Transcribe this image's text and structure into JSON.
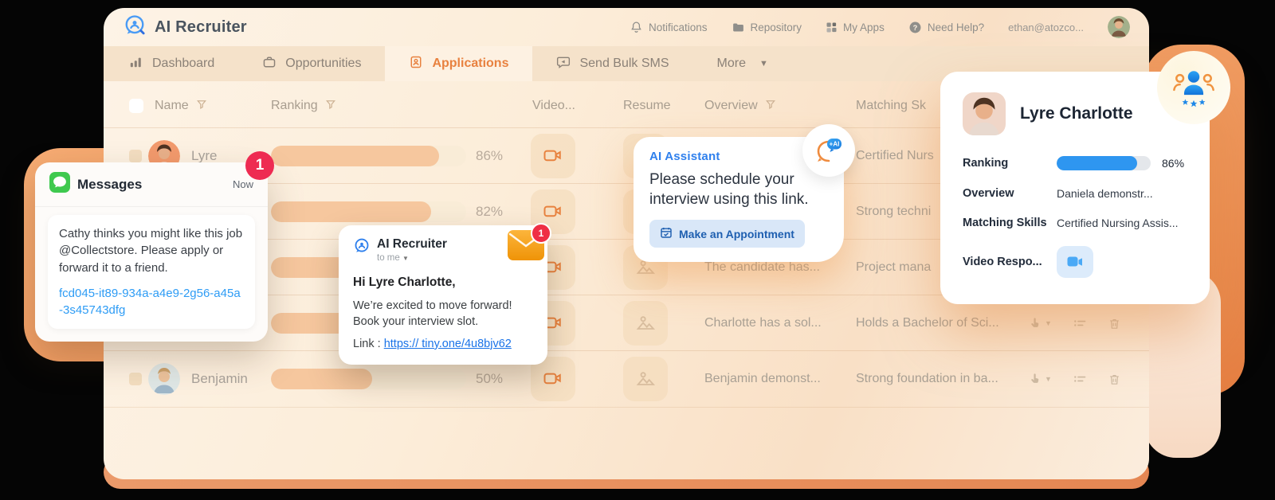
{
  "app": {
    "title": "AI Recruiter",
    "nav": [
      {
        "label": "Notifications"
      },
      {
        "label": "Repository"
      },
      {
        "label": "My Apps"
      },
      {
        "label": "Need Help?"
      }
    ],
    "account": "ethan@atozco...",
    "tabs": [
      {
        "label": "Dashboard"
      },
      {
        "label": "Opportunities"
      },
      {
        "label": "Applications"
      },
      {
        "label": "Send Bulk SMS"
      },
      {
        "label": "More"
      }
    ]
  },
  "table": {
    "headers": {
      "name": "Name",
      "ranking": "Ranking",
      "video": "Video...",
      "resume": "Resume",
      "overview": "Overview",
      "matching": "Matching Sk"
    },
    "rows": [
      {
        "name": "Lyre",
        "pct": "86%",
        "fill": 86,
        "overview": "",
        "matching": "Certified Nurs"
      },
      {
        "name": "",
        "pct": "82%",
        "fill": 82,
        "overview": "",
        "matching": "Strong techni"
      },
      {
        "name": "",
        "pct": "",
        "fill": 80,
        "overview": "The candidate has...",
        "matching": "Project mana"
      },
      {
        "name": "Charlotte",
        "pct": "",
        "fill": 76,
        "overview": "Charlotte has a sol...",
        "matching": "Holds a Bachelor of Sci..."
      },
      {
        "name": "Benjamin",
        "pct": "50%",
        "fill": 52,
        "overview": "Benjamin demonst...",
        "matching": "Strong foundation in ba..."
      }
    ]
  },
  "messages_card": {
    "app_name": "Messages",
    "time": "Now",
    "badge": "1",
    "body": "Cathy thinks you might like this job @Collectstore. Please apply or forward it to a friend.",
    "link": "fcd045-it89-934a-a4e9-2g56-a45a-3s45743dfg"
  },
  "email_card": {
    "sender": "AI Recruiter",
    "to": "to me",
    "badge": "1",
    "greeting": "Hi Lyre Charlotte,",
    "body_line1": "We’re excited to move forward!",
    "body_line2": "Book your interview slot.",
    "link_label": "Link :",
    "link": "https:// tiny.one/4u8bjv62"
  },
  "assistant_card": {
    "title": "AI Assistant",
    "message": "Please schedule your interview using this link.",
    "button": "Make an Appointment",
    "ai_badge": "+AI"
  },
  "candidate_card": {
    "name": "Lyre Charlotte",
    "ranking_label": "Ranking",
    "ranking_pct": "86%",
    "ranking_fill": 86,
    "overview_label": "Overview",
    "overview_value": "Daniela demonstr...",
    "matching_label": "Matching Skills",
    "matching_value": "Certified Nursing Assis...",
    "video_label": "Video Respo..."
  },
  "colors": {
    "accent_orange": "#E8813F",
    "link_blue": "#2196F3",
    "bar_blue": "#2E96F0",
    "badge_red": "#EE2B52",
    "bar_fill_tan": "#F6C79E"
  }
}
